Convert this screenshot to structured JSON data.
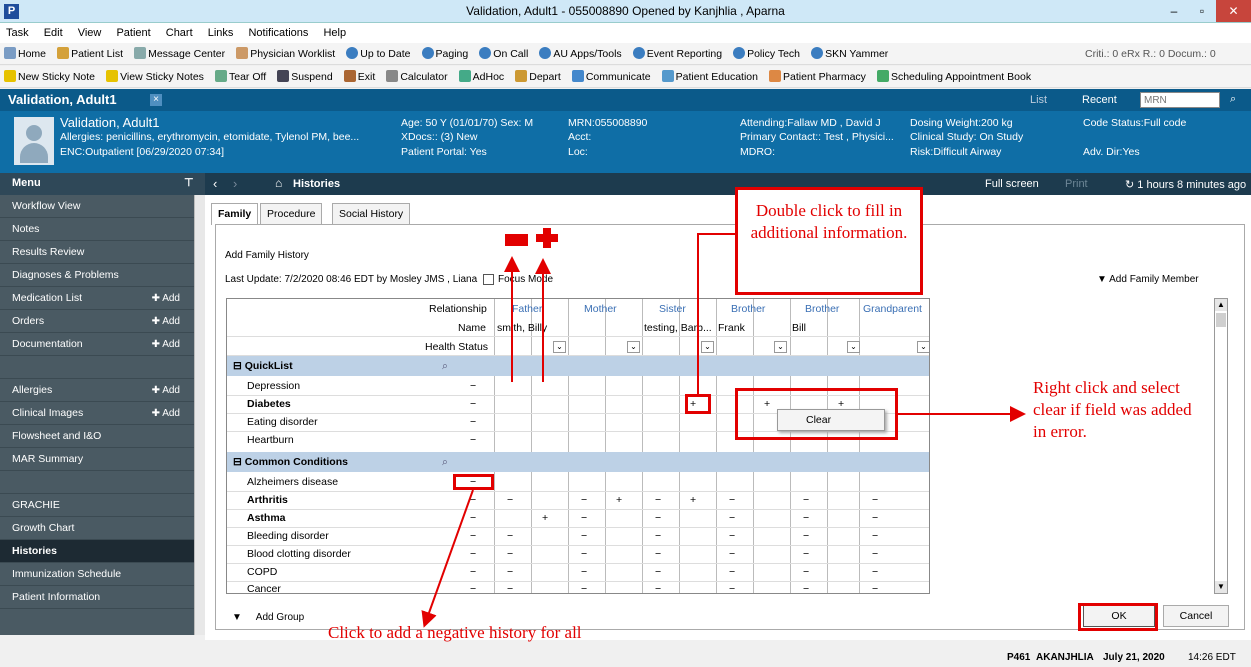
{
  "window": {
    "title": "Validation, Adult1 - 055008890 Opened by Kanjhlia , Aparna",
    "icon": "P",
    "minimize": "–",
    "maximize": "▫",
    "close": "✕"
  },
  "menubar": [
    "Task",
    "Edit",
    "View",
    "Patient",
    "Chart",
    "Links",
    "Notifications",
    "Help"
  ],
  "toolbar1": [
    "Home",
    "Patient List",
    "Message Center",
    "Physician Worklist",
    "Up to Date",
    "Paging",
    "On Call",
    "AU Apps/Tools",
    "Event Reporting",
    "Policy Tech",
    "SKN Yammer"
  ],
  "toolbar1_right": "Criti.: 0  eRx R.: 0  Docum.: 0",
  "toolbar2": [
    "New Sticky Note",
    "View Sticky Notes",
    "Tear Off",
    "Suspend",
    "Exit",
    "Calculator",
    "AdHoc",
    "Depart",
    "Communicate",
    "Patient Education",
    "Patient Pharmacy",
    "Scheduling Appointment Book"
  ],
  "patient_tab": {
    "name": "Validation, Adult1",
    "close": "×",
    "list_label": "List",
    "recent_label": "Recent",
    "mrn_placeholder": "MRN"
  },
  "banner": {
    "name": "Validation, Adult1",
    "allergies": "Allergies: penicillins, erythromycin, etomidate, Tylenol PM, bee...",
    "enc": "ENC:Outpatient [06/29/2020 07:34]",
    "age": "Age: 50 Y (01/01/70) Sex: M",
    "xdocs": "XDocs:: (3) New",
    "portal": "Patient Portal: Yes",
    "mrn": "MRN:055008890",
    "acct": "Acct:",
    "loc": "Loc:",
    "attending": "Attending:Fallaw MD , David J",
    "primary": "Primary Contact:: Test , Physici...",
    "mdro": "MDRO:",
    "dosing": "Dosing Weight:200 kg",
    "study": "Clinical Study: On Study",
    "risk": "Risk:Difficult Airway",
    "code": "Code Status:Full code",
    "advdir": "Adv. Dir:Yes"
  },
  "menu_title": "Menu",
  "sidebar": [
    {
      "label": "Workflow View",
      "add": ""
    },
    {
      "label": "Notes",
      "add": ""
    },
    {
      "label": "Results Review",
      "add": ""
    },
    {
      "label": "Diagnoses & Problems",
      "add": ""
    },
    {
      "label": "Medication List",
      "add": "Add"
    },
    {
      "label": "Orders",
      "add": "Add"
    },
    {
      "label": "Documentation",
      "add": "Add"
    },
    {
      "label": "",
      "add": ""
    },
    {
      "label": "Allergies",
      "add": "Add"
    },
    {
      "label": "Clinical Images",
      "add": "Add"
    },
    {
      "label": "Flowsheet and I&O",
      "add": ""
    },
    {
      "label": "MAR Summary",
      "add": ""
    },
    {
      "label": "",
      "add": ""
    },
    {
      "label": "GRACHIE",
      "add": ""
    },
    {
      "label": "Growth Chart",
      "add": ""
    },
    {
      "label": "Histories",
      "add": ""
    },
    {
      "label": "Immunization Schedule",
      "add": ""
    },
    {
      "label": "Patient Information",
      "add": ""
    }
  ],
  "content_header": {
    "title": "Histories",
    "fullscreen": "Full screen",
    "print": "Print",
    "refresh": "1 hours 8 minutes ago"
  },
  "tabs": [
    "Family",
    "Procedure",
    "Social History"
  ],
  "add_family_history": "Add Family History",
  "last_update": "Last Update: 7/2/2020 08:46 EDT by Mosley JMS , Liana",
  "focus_mode": "Focus Mode",
  "add_family_member": "Add Family Member",
  "grid": {
    "row_headers": [
      "Relationship",
      "Name",
      "Health Status"
    ],
    "members": [
      {
        "relationship": "Father",
        "name": "smith, Billy"
      },
      {
        "relationship": "Mother",
        "name": ""
      },
      {
        "relationship": "Sister",
        "name": "testing, Barb..."
      },
      {
        "relationship": "Brother",
        "name": "Frank"
      },
      {
        "relationship": "Brother",
        "name": "Bill"
      },
      {
        "relationship": "Grandparent",
        "name": ""
      }
    ],
    "sections": [
      {
        "title": "QuickList",
        "rows": [
          {
            "label": "Depression",
            "bold": false,
            "all": "−",
            "cells": [
              "",
              "",
              "",
              "",
              "",
              "",
              "",
              "",
              "",
              "",
              "",
              ""
            ]
          },
          {
            "label": "Diabetes",
            "bold": true,
            "all": "−",
            "cells": [
              "",
              "",
              "",
              "",
              "",
              "+",
              "",
              "+",
              "",
              "+",
              "",
              ""
            ]
          },
          {
            "label": "Eating disorder",
            "bold": false,
            "all": "−",
            "cells": [
              "",
              "",
              "",
              "",
              "",
              "",
              "",
              "",
              "",
              "",
              "",
              ""
            ]
          },
          {
            "label": "Heartburn",
            "bold": false,
            "all": "−",
            "cells": [
              "",
              "",
              "",
              "",
              "",
              "",
              "",
              "",
              "",
              "",
              "",
              ""
            ]
          }
        ]
      },
      {
        "title": "Common Conditions",
        "rows": [
          {
            "label": "Alzheimers disease",
            "bold": false,
            "all": "−",
            "cells": [
              "",
              "",
              "",
              "",
              "",
              "",
              "",
              "",
              "",
              "",
              "",
              ""
            ]
          },
          {
            "label": "Arthritis",
            "bold": true,
            "all": "−",
            "cells": [
              "−",
              "",
              "−",
              "+",
              "−",
              "+",
              "−",
              "",
              "−",
              "",
              "−",
              ""
            ]
          },
          {
            "label": "Asthma",
            "bold": true,
            "all": "−",
            "cells": [
              "",
              "+",
              "−",
              "",
              "−",
              "",
              "−",
              "",
              "−",
              "",
              "−",
              ""
            ]
          },
          {
            "label": "Bleeding disorder",
            "bold": false,
            "all": "−",
            "cells": [
              "−",
              "",
              "−",
              "",
              "−",
              "",
              "−",
              "",
              "−",
              "",
              "−",
              ""
            ]
          },
          {
            "label": "Blood clotting disorder",
            "bold": false,
            "all": "−",
            "cells": [
              "−",
              "",
              "−",
              "",
              "−",
              "",
              "−",
              "",
              "−",
              "",
              "−",
              ""
            ]
          },
          {
            "label": "COPD",
            "bold": false,
            "all": "−",
            "cells": [
              "−",
              "",
              "−",
              "",
              "−",
              "",
              "−",
              "",
              "−",
              "",
              "−",
              ""
            ]
          },
          {
            "label": "Cancer",
            "bold": false,
            "all": "−",
            "cells": [
              "−",
              "",
              "−",
              "",
              "−",
              "",
              "−",
              "",
              "−",
              "",
              "−",
              ""
            ]
          }
        ]
      }
    ]
  },
  "context_menu_item": "Clear",
  "add_group": "Add Group",
  "ok_button": "OK",
  "cancel_button": "Cancel",
  "status": {
    "code": "P461",
    "user": "AKANJHLIA",
    "date": "July 21, 2020",
    "time": "14:26 EDT"
  },
  "annotations": {
    "double_click": "Double click to fill in additional information.",
    "right_click": "Right click and select clear if field was added in error.",
    "negative": "Click to add a negative history for all family members listed."
  },
  "colors": {
    "annotation": "#e20000",
    "banner": "#0f6ea6",
    "sidebar": "#4a5a63",
    "section": "#bdd1e6"
  }
}
